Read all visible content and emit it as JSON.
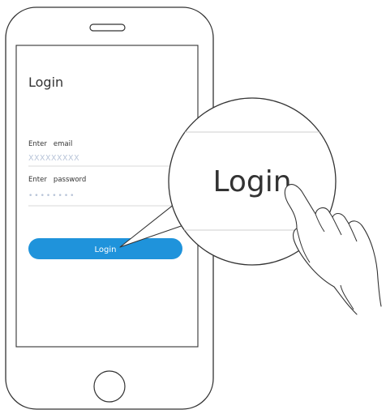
{
  "screen": {
    "title": "Login",
    "email_label": "Enter   email",
    "email_value": "XXXXXXXXX",
    "password_label": "Enter   password",
    "password_value": "••••••••",
    "login_button_label": "Login"
  },
  "zoom": {
    "button_label": "Login"
  },
  "colors": {
    "outline": "#333333",
    "divider": "#cfcfcf",
    "button": "#1f93db",
    "button_text": "#ffffff",
    "placeholder": "#b8c4d8",
    "label": "#333333"
  }
}
